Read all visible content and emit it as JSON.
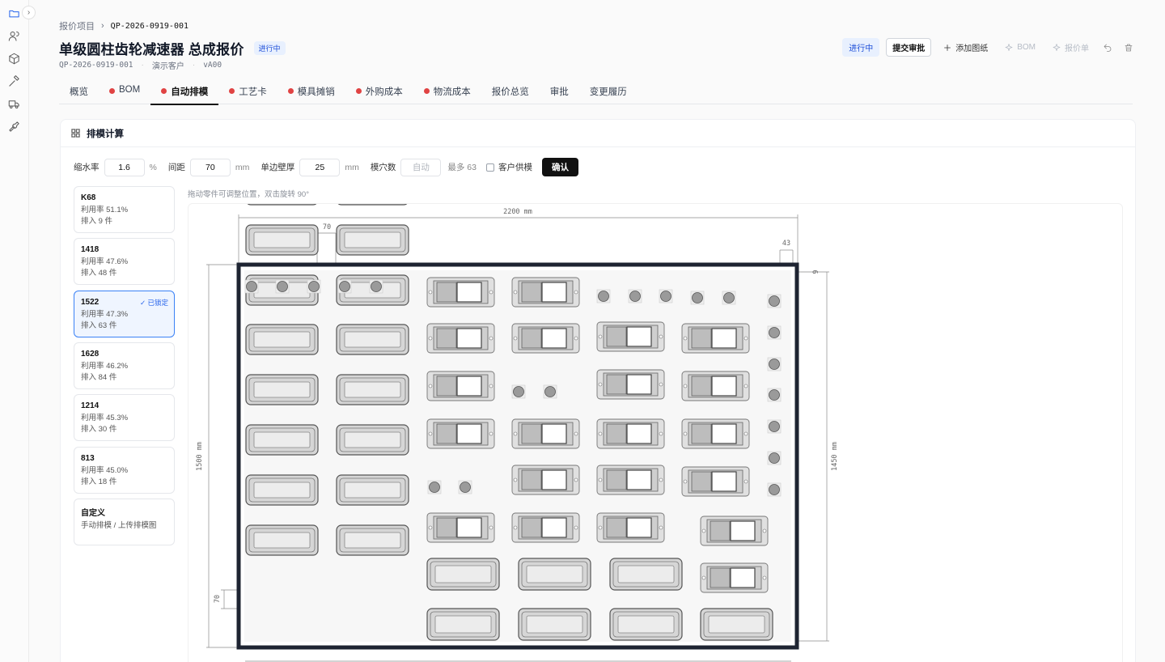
{
  "breadcrumb": {
    "root": "报价项目",
    "current": "QP-2026-0919-001"
  },
  "header": {
    "title": "单级圆柱齿轮减速器 总成报价",
    "status_badge": "进行中",
    "code": "QP-2026-0919-001",
    "customer": "演示客户",
    "version": "vA00"
  },
  "actions": {
    "status": "进行中",
    "submit": "提交审批",
    "add_drawing": "添加图纸",
    "bom": "BOM",
    "quote": "报价单"
  },
  "tabs": [
    {
      "label": "概览",
      "dot": false
    },
    {
      "label": "BOM",
      "dot": true
    },
    {
      "label": "自动排模",
      "dot": true,
      "active": true
    },
    {
      "label": "工艺卡",
      "dot": true
    },
    {
      "label": "模具摊销",
      "dot": true
    },
    {
      "label": "外购成本",
      "dot": true
    },
    {
      "label": "物流成本",
      "dot": true
    },
    {
      "label": "报价总览",
      "dot": false
    },
    {
      "label": "审批",
      "dot": false
    },
    {
      "label": "变更履历",
      "dot": false
    }
  ],
  "panel": {
    "title": "排模计算",
    "params": {
      "shrink_label": "缩水率",
      "shrink_value": "1.6",
      "shrink_unit": "%",
      "gap_label": "间距",
      "gap_value": "70",
      "gap_unit": "mm",
      "wall_label": "单边壁厚",
      "wall_value": "25",
      "wall_unit": "mm",
      "cavity_label": "模穴数",
      "cavity_placeholder": "自动",
      "cavity_max": "最多 63",
      "customer_mold_label": "客户供模",
      "confirm": "确认"
    },
    "hint": "拖动零件可调整位置，双击旋转 90°",
    "candidates": [
      {
        "name": "K68",
        "util": "利用率 51.1%",
        "count": "排入 9 件"
      },
      {
        "name": "1418",
        "util": "利用率 47.6%",
        "count": "排入 48 件"
      },
      {
        "name": "1522",
        "util": "利用率 47.3%",
        "count": "排入 63 件",
        "locked": "✓ 已锁定"
      },
      {
        "name": "1628",
        "util": "利用率 46.2%",
        "count": "排入 84 件"
      },
      {
        "name": "1214",
        "util": "利用率 45.3%",
        "count": "排入 30 件"
      },
      {
        "name": "813",
        "util": "利用率 45.0%",
        "count": "排入 18 件"
      },
      {
        "name": "自定义",
        "util": "手动排模 / 上传排模图",
        "count": ""
      }
    ],
    "dims": {
      "width": "2200 mm",
      "height_outer": "1500 mm",
      "height_inner": "1450 mm",
      "gap_top": "70",
      "margin_right": "43",
      "gap_left": "70",
      "right_small": "9"
    }
  },
  "colors": {
    "accent": "#2563eb",
    "frame": "#1e2432",
    "dot": "#e04343"
  },
  "icons": [
    "folder-icon",
    "users-icon",
    "box-icon",
    "hammer-icon",
    "truck-icon",
    "wrench-icon"
  ]
}
